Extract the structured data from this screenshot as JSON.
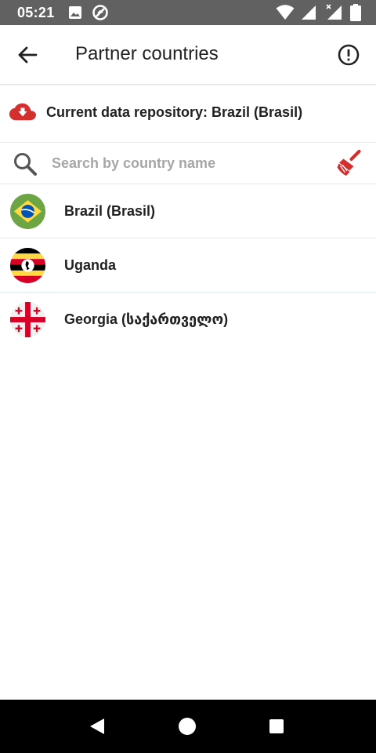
{
  "status_bar": {
    "time": "05:21",
    "left_icons": [
      "image-icon",
      "do-not-disturb-icon"
    ],
    "right_icons": [
      "wifi-icon",
      "cell-signal-icon",
      "cell-signal-no-data-icon",
      "battery-icon"
    ]
  },
  "app_bar": {
    "title": "Partner countries",
    "back_icon": "arrow-back-icon",
    "info_icon": "info-circle-icon"
  },
  "repository": {
    "text": "Current data repository: Brazil (Brasil)",
    "icon": "cloud-download-icon",
    "icon_color": "#d32f2f"
  },
  "search": {
    "value": "",
    "placeholder": "Search by country name",
    "icon": "search-icon",
    "clear_icon": "broom-icon",
    "clear_color": "#d32f2f"
  },
  "countries": [
    {
      "name": "Brazil (Brasil)",
      "flag": "brazil-flag"
    },
    {
      "name": "Uganda",
      "flag": "uganda-flag"
    },
    {
      "name": "Georgia (საქართველო)",
      "flag": "georgia-flag"
    }
  ],
  "nav_bar": {
    "buttons": [
      "back-triangle-icon",
      "home-circle-icon",
      "recents-square-icon"
    ]
  }
}
